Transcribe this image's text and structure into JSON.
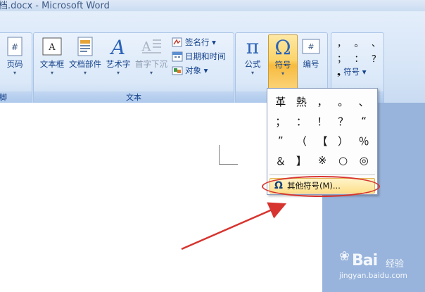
{
  "window": {
    "title": "档.docx - Microsoft Word"
  },
  "ribbon": {
    "group_left_partial": {
      "label": "脚"
    },
    "page_button": {
      "label": "页码"
    },
    "text_group": {
      "label": "文本",
      "buttons": [
        {
          "label": "文本框"
        },
        {
          "label": "文档部件"
        },
        {
          "label": "艺术字"
        },
        {
          "label": "首字下沉",
          "disabled": true
        }
      ],
      "small_buttons": [
        {
          "label": "签名行 ▾"
        },
        {
          "label": "日期和时间"
        },
        {
          "label": "对象 ▾"
        }
      ]
    },
    "symbol_group": {
      "buttons": [
        {
          "label": "公式"
        },
        {
          "label": "符号"
        },
        {
          "label": "编号"
        }
      ]
    },
    "special_group": {
      "chars_row1": [
        "，",
        "。",
        "、"
      ],
      "chars_row2": [
        "；",
        "：",
        "？"
      ],
      "symbol_label": "符号 ▾"
    }
  },
  "dropdown": {
    "symbols": [
      "革",
      "熱",
      "，",
      "。",
      "、",
      "；",
      "：",
      "！",
      "？",
      "“",
      "”",
      "（",
      "【",
      "）",
      "％",
      "＆",
      "】",
      "※",
      "○",
      "◎"
    ],
    "more_symbols_label": "其他符号(M)..."
  },
  "watermark": {
    "brand": "Bai",
    "brand_suffix": "经验",
    "url": "jingyan.baidu.com"
  },
  "colors": {
    "highlight": "#d7342f",
    "ribbon": "#dae8f8",
    "active": "#fbd46a"
  }
}
